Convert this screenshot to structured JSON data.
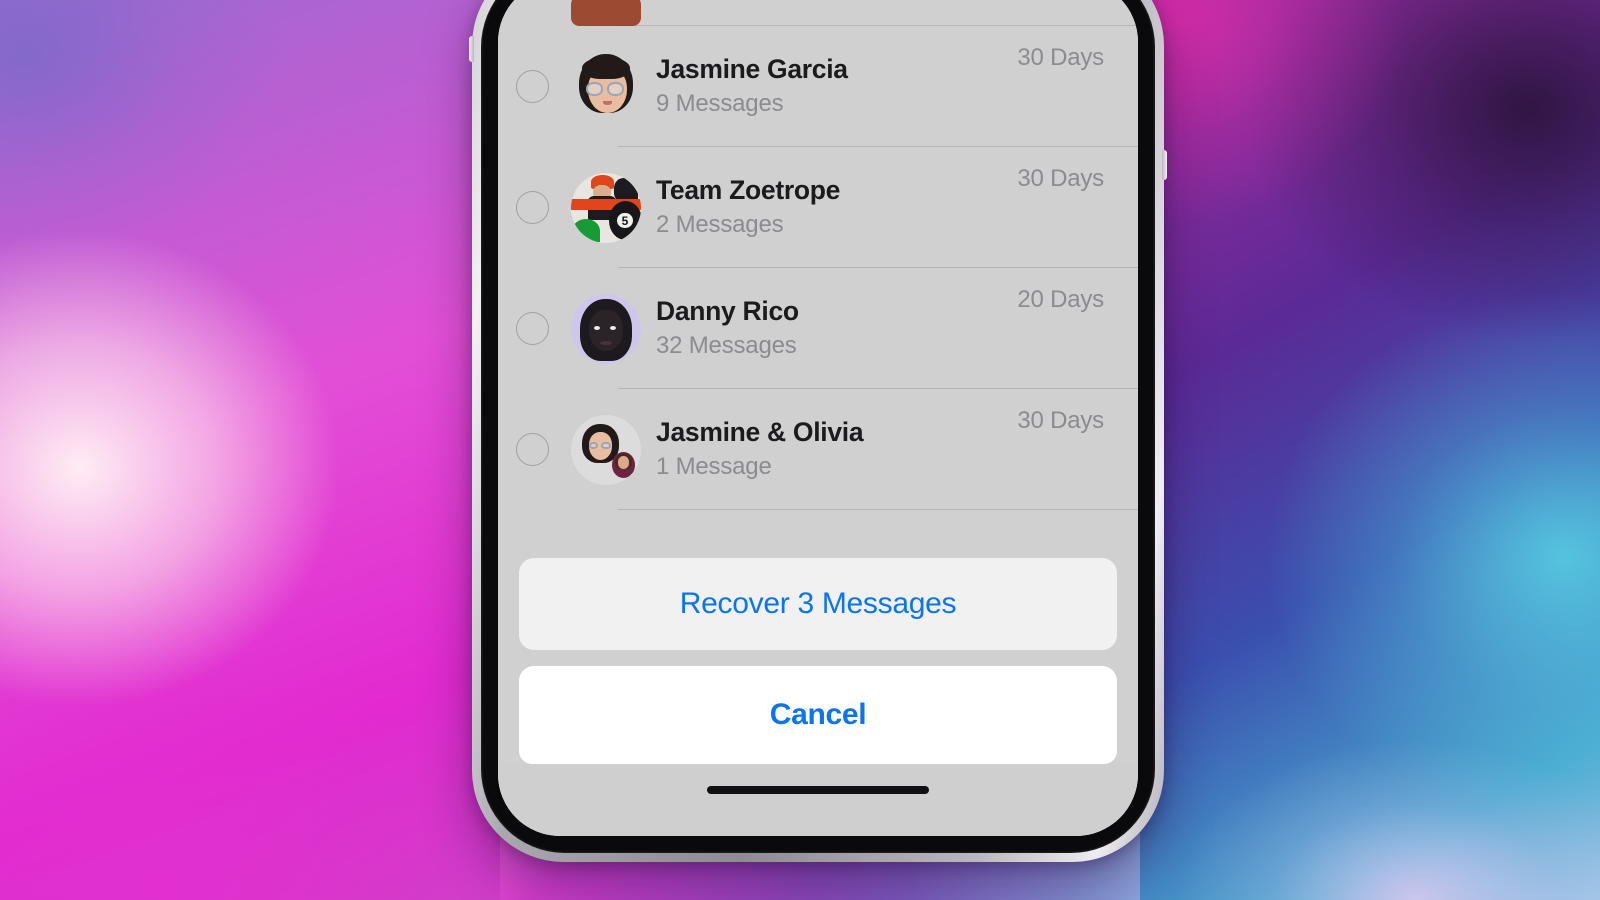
{
  "screen": {
    "sheet_background": "#d0d0d1",
    "accent_color": "#0b74f0"
  },
  "conversation_list": {
    "rows": [
      {
        "id": "partial-row",
        "name": "",
        "subtitle": "",
        "retention": "",
        "avatar": "cut-off-avatar",
        "selected": false,
        "partial": true
      },
      {
        "id": "jasmine-garcia",
        "name": "Jasmine Garcia",
        "subtitle": "9 Messages",
        "retention": "30 Days",
        "avatar": "memoji-jasmine",
        "selected": false,
        "partial": false
      },
      {
        "id": "team-zoetrope",
        "name": "Team Zoetrope",
        "subtitle": "2 Messages",
        "retention": "30 Days",
        "avatar": "photo-team-zoetrope",
        "selected": false,
        "partial": false
      },
      {
        "id": "danny-rico",
        "name": "Danny Rico",
        "subtitle": "32 Messages",
        "retention": "20 Days",
        "avatar": "memoji-danny",
        "selected": false,
        "partial": false
      },
      {
        "id": "jasmine-olivia",
        "name": "Jasmine & Olivia",
        "subtitle": "1 Message",
        "retention": "30 Days",
        "avatar": "memoji-group",
        "selected": false,
        "partial": false
      }
    ]
  },
  "actions": {
    "recover_label": "Recover 3 Messages",
    "cancel_label": "Cancel"
  },
  "team_zoetrope_avatar": {
    "ball_number": "5"
  }
}
